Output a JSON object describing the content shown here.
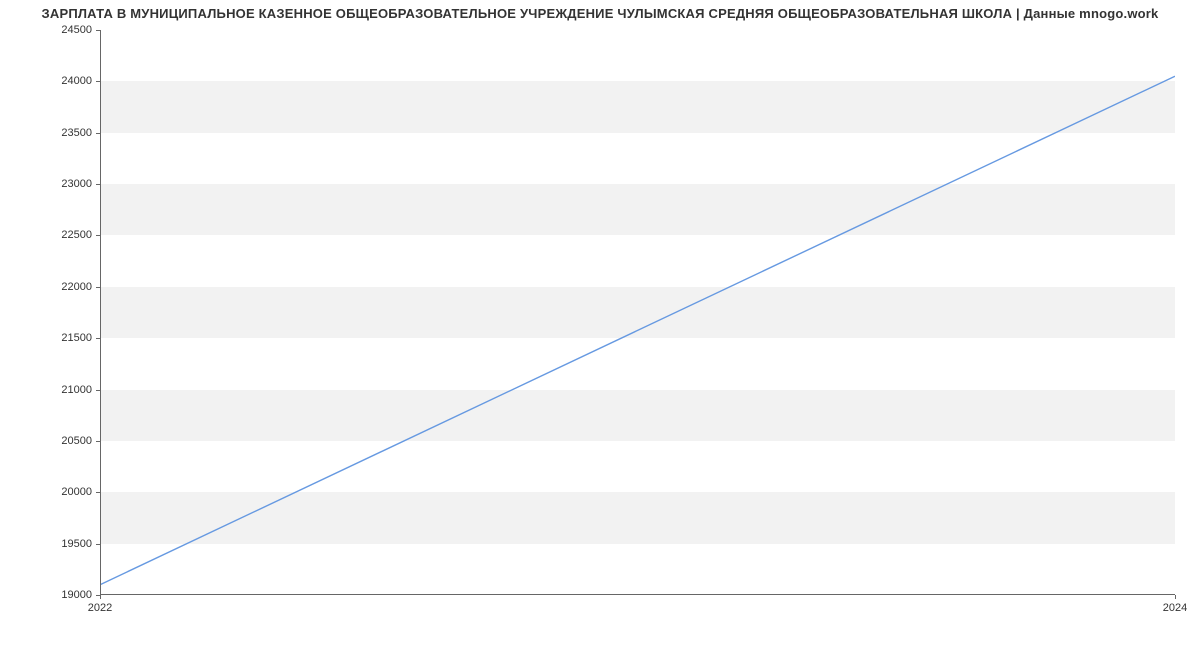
{
  "chart_data": {
    "type": "line",
    "title": "ЗАРПЛАТА В МУНИЦИПАЛЬНОЕ КАЗЕННОЕ ОБЩЕОБРАЗОВАТЕЛЬНОЕ УЧРЕЖДЕНИЕ ЧУЛЫМСКАЯ СРЕДНЯЯ ОБЩЕОБРАЗОВАТЕЛЬНАЯ ШКОЛА | Данные mnogo.work",
    "xlabel": "",
    "ylabel": "",
    "x": [
      2022,
      2024
    ],
    "values": [
      19100,
      24050
    ],
    "x_ticks": [
      2022,
      2024
    ],
    "y_ticks": [
      19000,
      19500,
      20000,
      20500,
      21000,
      21500,
      22000,
      22500,
      23000,
      23500,
      24000,
      24500
    ],
    "xlim": [
      2022,
      2024
    ],
    "ylim": [
      19000,
      24500
    ],
    "line_color": "#6699e1",
    "grid_band_color": "#f2f2f2"
  }
}
